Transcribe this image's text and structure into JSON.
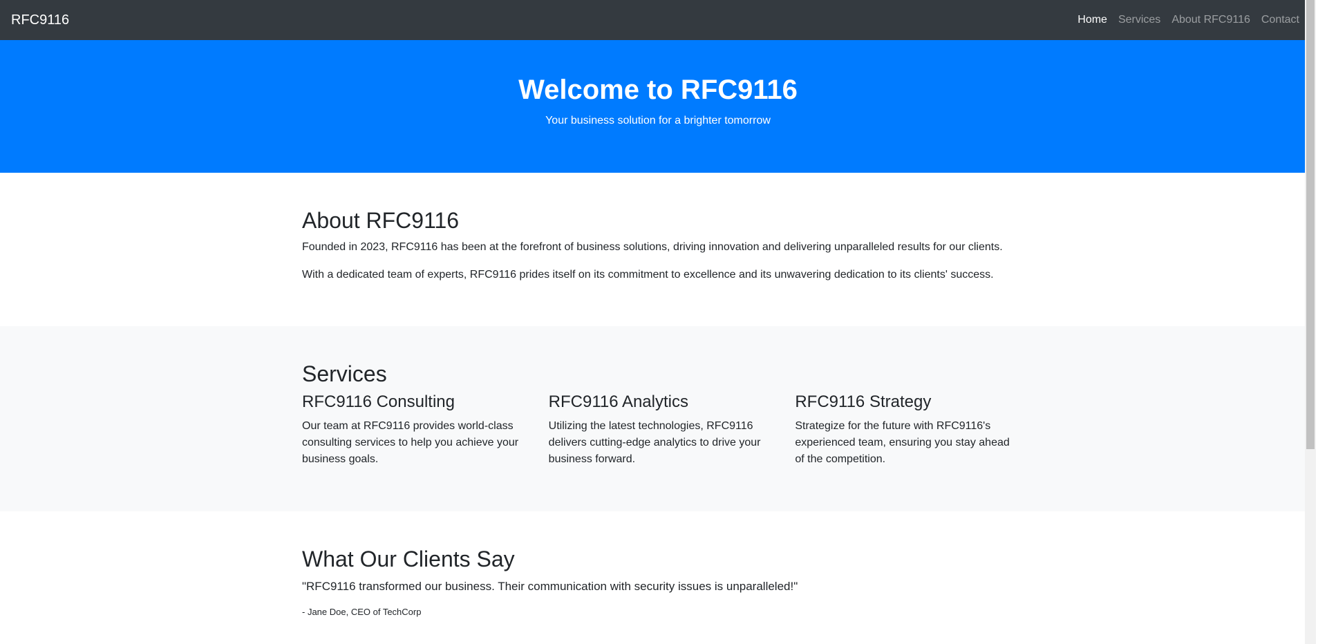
{
  "navbar": {
    "brand": "RFC9116",
    "links": [
      {
        "label": "Home",
        "active": true
      },
      {
        "label": "Services",
        "active": false
      },
      {
        "label": "About RFC9116",
        "active": false
      },
      {
        "label": "Contact",
        "active": false
      }
    ]
  },
  "hero": {
    "title": "Welcome to RFC9116",
    "subtitle": "Your business solution for a brighter tomorrow"
  },
  "about": {
    "title": "About RFC9116",
    "paragraphs": [
      "Founded in 2023, RFC9116 has been at the forefront of business solutions, driving innovation and delivering unparalleled results for our clients.",
      "With a dedicated team of experts, RFC9116 prides itself on its commitment to excellence and its unwavering dedication to its clients' success."
    ]
  },
  "services": {
    "title": "Services",
    "items": [
      {
        "title": "RFC9116 Consulting",
        "text": "Our team at RFC9116 provides world-class consulting services to help you achieve your business goals."
      },
      {
        "title": "RFC9116 Analytics",
        "text": "Utilizing the latest technologies, RFC9116 delivers cutting-edge analytics to drive your business forward."
      },
      {
        "title": "RFC9116 Strategy",
        "text": "Strategize for the future with RFC9116's experienced team, ensuring you stay ahead of the competition."
      }
    ]
  },
  "testimonials": {
    "title": "What Our Clients Say",
    "quote": "\"RFC9116 transformed our business. Their communication with security issues is unparalleled!\"",
    "author": "- Jane Doe, CEO of TechCorp"
  },
  "colors": {
    "navbar": "#343a40",
    "hero": "#007bff",
    "light_section": "#f8f9fa"
  }
}
